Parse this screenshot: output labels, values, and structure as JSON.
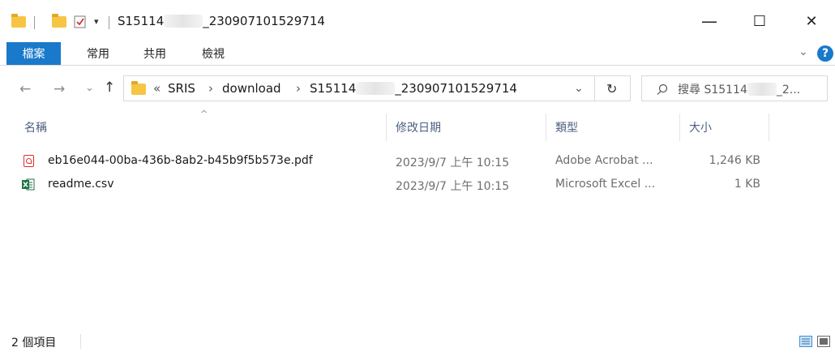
{
  "window": {
    "title_prefix": "S15114",
    "title_suffix": "_230907101529714",
    "minimize": "—",
    "maximize": "☐",
    "close": "✕"
  },
  "ribbon": {
    "tabs": [
      "檔案",
      "常用",
      "共用",
      "檢視"
    ],
    "expand": "⌄",
    "help": "?"
  },
  "nav": {
    "back": "←",
    "forward": "→",
    "recent": "⌄",
    "up": "↑",
    "overflow": "«",
    "breadcrumb": [
      "SRIS",
      "download",
      "S15114",
      "_230907101529714"
    ],
    "separator": "›",
    "dropdown": "⌄",
    "refresh": "↻",
    "search_prefix": "搜尋 S15114",
    "search_suffix": "_2..."
  },
  "columns": {
    "name": "名稱",
    "modified": "修改日期",
    "type": "類型",
    "size": "大小",
    "sort_indicator": "^"
  },
  "files": [
    {
      "name": "eb16e044-00ba-436b-8ab2-b45b9f5b573e.pdf",
      "modified": "2023/9/7 上午 10:15",
      "type": "Adobe Acrobat ...",
      "size": "1,246 KB",
      "icon": "pdf-icon"
    },
    {
      "name": "readme.csv",
      "modified": "2023/9/7 上午 10:15",
      "type": "Microsoft Excel ...",
      "size": "1 KB",
      "icon": "excel-csv-icon"
    }
  ],
  "status": {
    "item_count": "2 個項目"
  },
  "colors": {
    "accent": "#1979ca",
    "header_text": "#4d6082",
    "folder": "#f6c544",
    "pdf": "#d9302b",
    "excel": "#1f7244"
  }
}
